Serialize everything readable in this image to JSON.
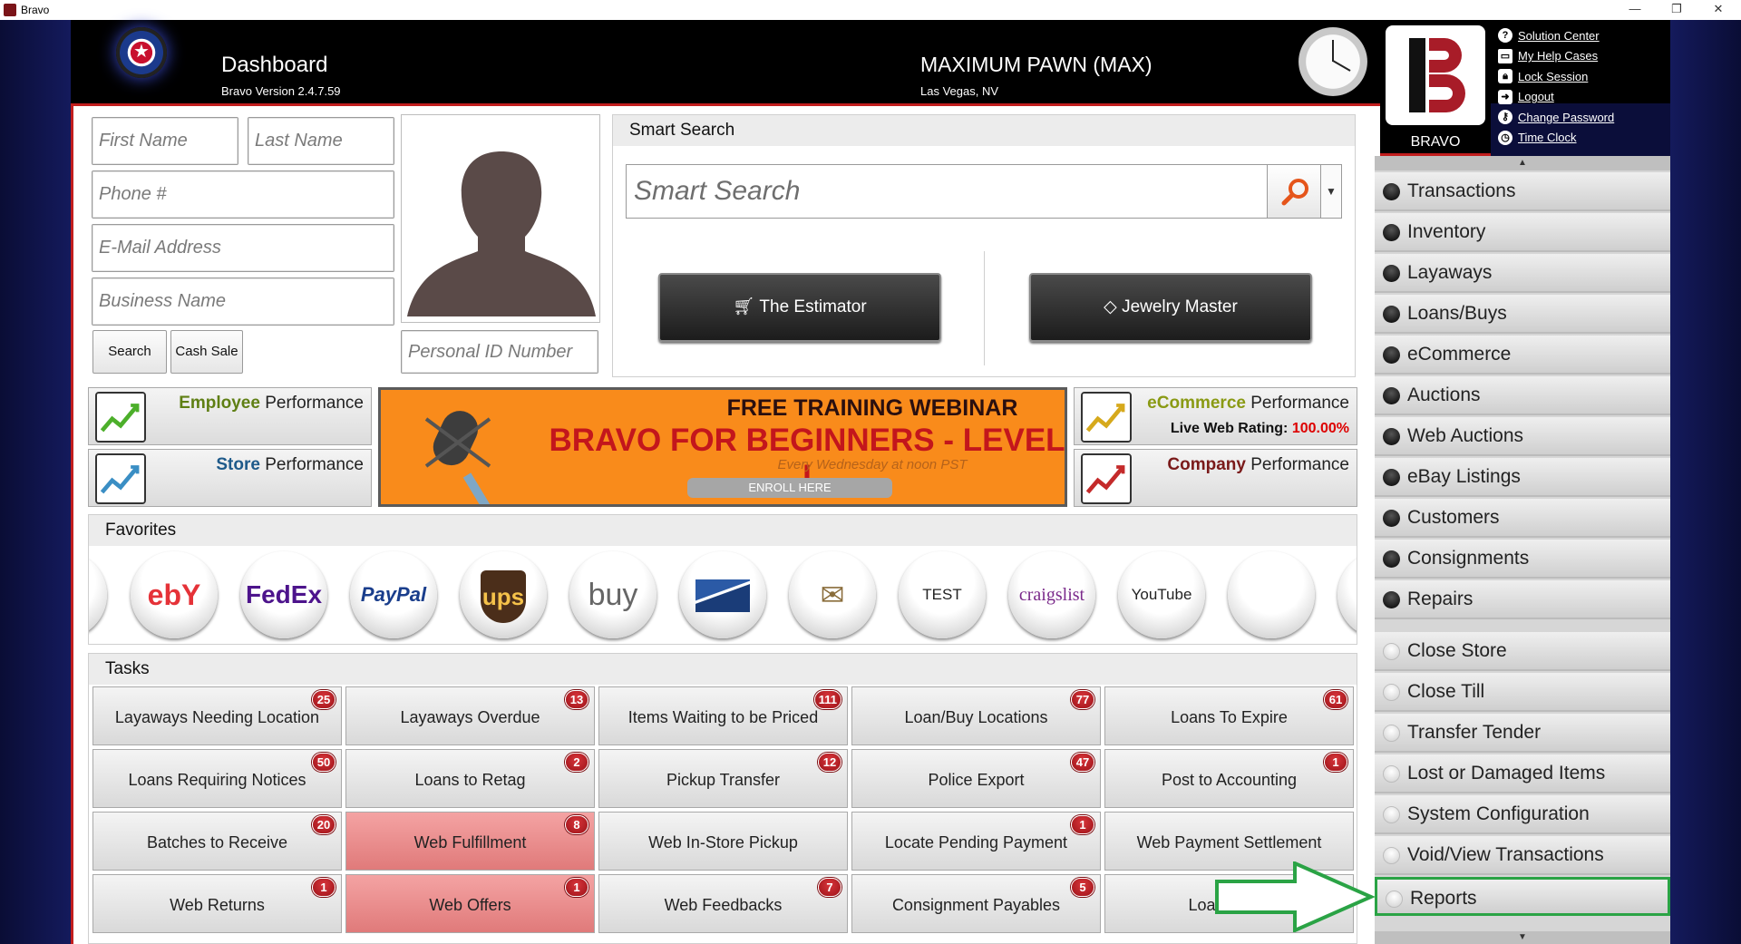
{
  "window": {
    "title": "Bravo",
    "minimize": "—",
    "restore": "❐",
    "close": "✕"
  },
  "header": {
    "title": "Dashboard",
    "version": "Bravo Version 2.4.7.59",
    "store_name": "MAXIMUM PAWN (MAX)",
    "store_city": "Las Vegas, NV",
    "brand_label": "BRAVO"
  },
  "top_links": [
    {
      "label": "Solution Center",
      "icon": "help-circle-icon"
    },
    {
      "label": "My Help Cases",
      "icon": "folder-icon"
    },
    {
      "label": "Lock Session",
      "icon": "lock-icon"
    },
    {
      "label": "Logout",
      "icon": "logout-icon"
    },
    {
      "label": "Change Password",
      "icon": "key-icon"
    },
    {
      "label": "Time Clock",
      "icon": "clock-icon"
    }
  ],
  "customer_search": {
    "first_name_placeholder": "First Name",
    "last_name_placeholder": "Last Name",
    "phone_placeholder": "Phone #",
    "email_placeholder": "E-Mail Address",
    "business_placeholder": "Business Name",
    "personal_id_placeholder": "Personal ID Number",
    "search_label": "Search",
    "cash_sale_label": "Cash Sale"
  },
  "smart_search": {
    "title": "Smart Search",
    "placeholder": "Smart Search",
    "estimator_label": "The Estimator",
    "jewelry_label": "Jewelry Master"
  },
  "performance": {
    "employee": {
      "highlight": "Employee",
      "rest": " Performance"
    },
    "store": {
      "highlight": "Store",
      "rest": " Performance"
    },
    "ecommerce": {
      "highlight": "eCommerce",
      "rest": " Performance",
      "rating_label": "Live Web Rating: ",
      "rating_value": "100.00%"
    },
    "company": {
      "highlight": "Company",
      "rest": " Performance"
    }
  },
  "banner": {
    "line1": "FREE TRAINING WEBINAR",
    "line2": "BRAVO FOR BEGINNERS - LEVEL I",
    "line3": "Every Wednesday at noon PST",
    "button": "ENROLL HERE"
  },
  "favorites": {
    "title": "Favorites",
    "items": [
      "ebY",
      "FedEx",
      "PayPal",
      "ups",
      "buy",
      "",
      "",
      "TEST",
      "craigslist",
      "YouTube",
      ""
    ]
  },
  "tasks": {
    "title": "Tasks",
    "items": [
      {
        "label": "Layaways Needing Location",
        "count": "25"
      },
      {
        "label": "Layaways Overdue",
        "count": "13"
      },
      {
        "label": "Items Waiting to be Priced",
        "count": "111"
      },
      {
        "label": "Loan/Buy Locations",
        "count": "77"
      },
      {
        "label": "Loans To Expire",
        "count": "61"
      },
      {
        "label": "Loans Requiring Notices",
        "count": "50"
      },
      {
        "label": "Loans to Retag",
        "count": "2"
      },
      {
        "label": "Pickup Transfer",
        "count": "12"
      },
      {
        "label": "Police Export",
        "count": "47"
      },
      {
        "label": "Post to Accounting",
        "count": "1"
      },
      {
        "label": "Batches to Receive",
        "count": "20"
      },
      {
        "label": "Web Fulfillment",
        "count": "8"
      },
      {
        "label": "Web In-Store Pickup",
        "count": ""
      },
      {
        "label": "Locate Pending Payment",
        "count": "1"
      },
      {
        "label": "Web Payment Settlement",
        "count": ""
      },
      {
        "label": "Web Returns",
        "count": "1"
      },
      {
        "label": "Web Offers",
        "count": "1"
      },
      {
        "label": "Web Feedbacks",
        "count": "7"
      },
      {
        "label": "Consignment Payables",
        "count": "5"
      },
      {
        "label": "Loans Batc",
        "count": ""
      }
    ]
  },
  "menu": {
    "modules": [
      "Transactions",
      "Inventory",
      "Layaways",
      "Loans/Buys",
      "eCommerce",
      "Auctions",
      "Web Auctions",
      "eBay Listings",
      "Customers",
      "Consignments",
      "Repairs"
    ],
    "admin": [
      "Close Store",
      "Close Till",
      "Transfer Tender",
      "Lost or Damaged Items",
      "System Configuration",
      "Void/View Transactions",
      "Reports"
    ],
    "selected": "Reports"
  }
}
